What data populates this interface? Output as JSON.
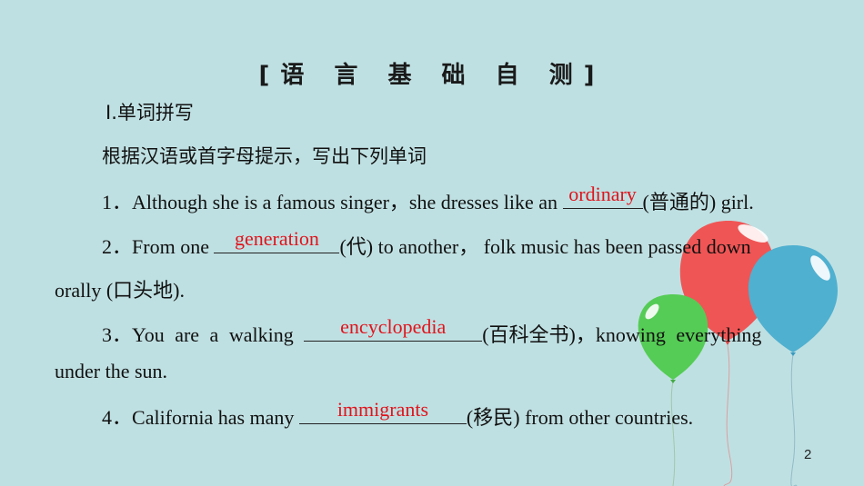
{
  "title": "[语 言 基 础 自 测]",
  "section_heading": "Ⅰ.单词拼写",
  "instruction": "根据汉语或首字母提示，写出下列单词",
  "questions": [
    {
      "number": "1．",
      "before": "Although she is a famous singer，she dresses like an ",
      "answer": "ordinary",
      "after": "(普通的) girl.",
      "continuation": ""
    },
    {
      "number": "2．",
      "before": "From one ",
      "answer": "generation",
      "after": "(代) to another， folk music has been passed down",
      "continuation": "orally (口头地)."
    },
    {
      "number": "3．",
      "before": "You are a walking ",
      "answer": "encyclopedia",
      "after": "(百科全书)，knowing everything",
      "continuation": "under the sun."
    },
    {
      "number": "4．",
      "before": "California has many ",
      "answer": "immigrants",
      "after": "(移民) from other countries.",
      "continuation": ""
    }
  ],
  "page_number": "2",
  "colors": {
    "background": "#bfe0e2",
    "answer": "#e0141c",
    "balloon_red": "#f05555",
    "balloon_blue": "#4fb0d0",
    "balloon_green": "#55cc55"
  }
}
